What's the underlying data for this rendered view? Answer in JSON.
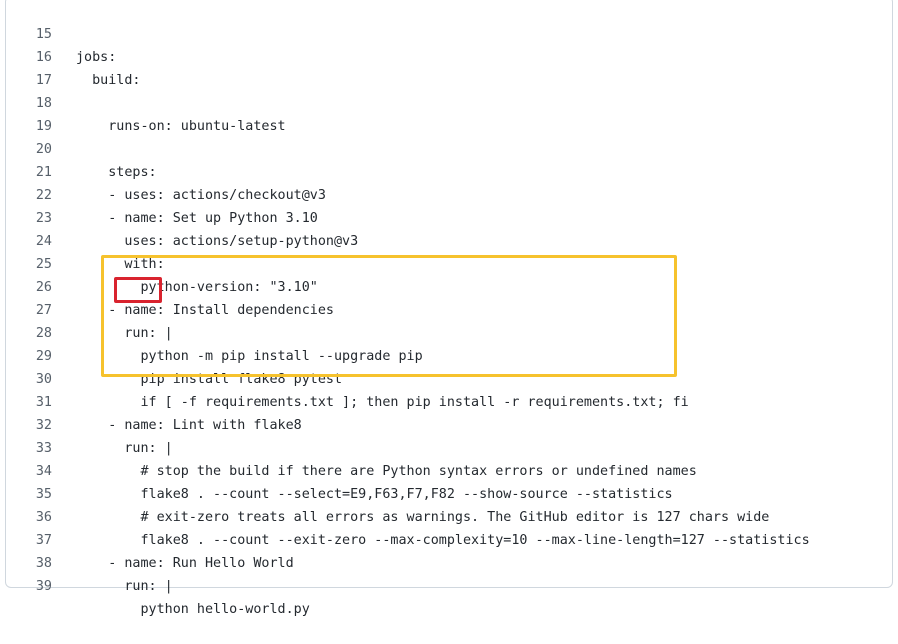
{
  "editor": {
    "lines": [
      {
        "num": "15",
        "text": "jobs:"
      },
      {
        "num": "16",
        "text": "  build:"
      },
      {
        "num": "17",
        "text": ""
      },
      {
        "num": "18",
        "text": "    runs-on: ubuntu-latest"
      },
      {
        "num": "19",
        "text": ""
      },
      {
        "num": "20",
        "text": "    steps:"
      },
      {
        "num": "21",
        "text": "    - uses: actions/checkout@v3"
      },
      {
        "num": "22",
        "text": "    - name: Set up Python 3.10"
      },
      {
        "num": "23",
        "text": "      uses: actions/setup-python@v3"
      },
      {
        "num": "24",
        "text": "      with:"
      },
      {
        "num": "25",
        "text": "        python-version: \"3.10\""
      },
      {
        "num": "26",
        "text": "    - name: Install dependencies"
      },
      {
        "num": "27",
        "text": "      run: |"
      },
      {
        "num": "28",
        "text": "        python -m pip install --upgrade pip"
      },
      {
        "num": "29",
        "text": "        pip install flake8 pytest"
      },
      {
        "num": "30",
        "text": "        if [ -f requirements.txt ]; then pip install -r requirements.txt; fi"
      },
      {
        "num": "31",
        "text": "    - name: Lint with flake8"
      },
      {
        "num": "32",
        "text": "      run: |"
      },
      {
        "num": "33",
        "text": "        # stop the build if there are Python syntax errors or undefined names"
      },
      {
        "num": "34",
        "text": "        flake8 . --count --select=E9,F63,F7,F82 --show-source --statistics"
      },
      {
        "num": "35",
        "text": "        # exit-zero treats all errors as warnings. The GitHub editor is 127 chars wide"
      },
      {
        "num": "36",
        "text": "        flake8 . --count --exit-zero --max-complexity=10 --max-line-length=127 --statistics"
      },
      {
        "num": "37",
        "text": "    - name: Run Hello World"
      },
      {
        "num": "38",
        "text": "      run: |"
      },
      {
        "num": "39",
        "text": "        python hello-world.py"
      }
    ]
  },
  "highlights": {
    "block_color": "#f6c22d",
    "run_color": "#d9232e"
  }
}
